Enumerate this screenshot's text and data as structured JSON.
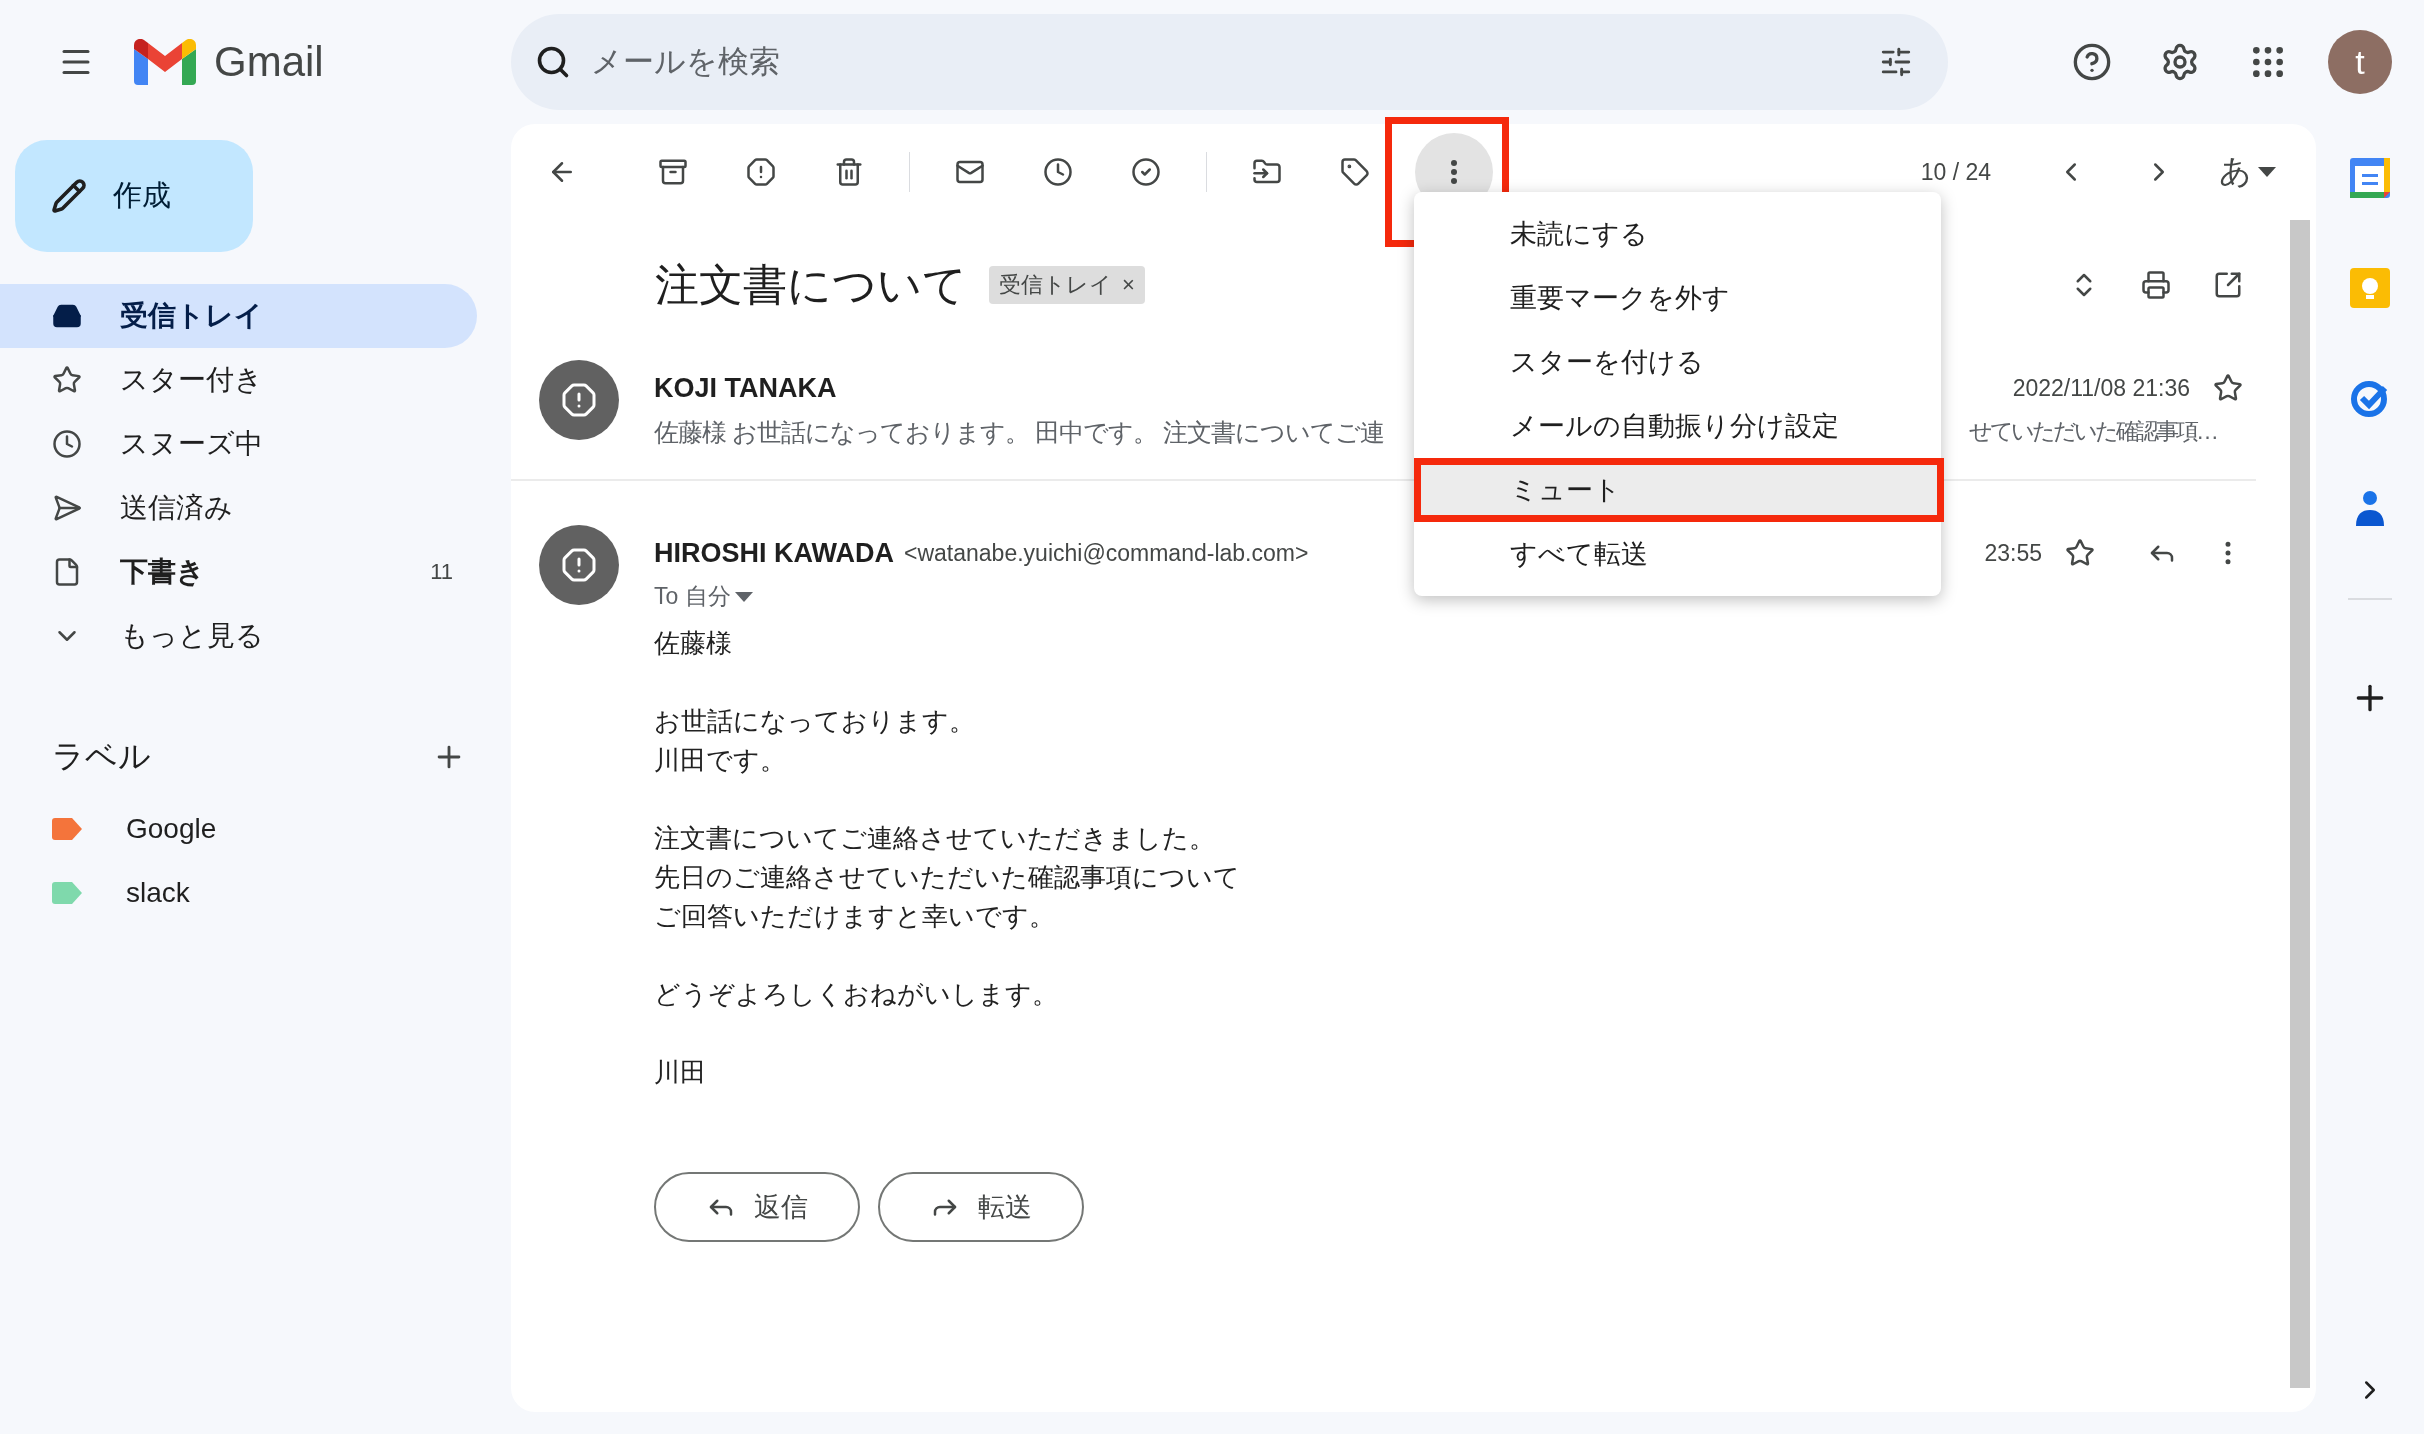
{
  "app": {
    "name": "Gmail"
  },
  "search": {
    "placeholder": "メールを検索"
  },
  "account": {
    "initial": "t"
  },
  "compose": {
    "label": "作成"
  },
  "nav": [
    {
      "label": "受信トレイ",
      "selected": true,
      "bold": true
    },
    {
      "label": "スター付き",
      "selected": false,
      "bold": false
    },
    {
      "label": "スヌーズ中",
      "selected": false,
      "bold": false
    },
    {
      "label": "送信済み",
      "selected": false,
      "bold": false
    },
    {
      "label": "下書き",
      "selected": false,
      "bold": true,
      "count": "11"
    },
    {
      "label": "もっと見る",
      "selected": false,
      "bold": false
    }
  ],
  "labels": {
    "title": "ラベル",
    "items": [
      {
        "name": "Google",
        "color": "#f4743b"
      },
      {
        "name": "slack",
        "color": "#7fd9ac"
      }
    ]
  },
  "toolbar": {
    "position": "10 / 24",
    "input_mode": "あ",
    "more_highlighted": true
  },
  "thread": {
    "subject": "注文書について",
    "tag": "受信トレイ",
    "tag_close": "×"
  },
  "messages": [
    {
      "kind": "collapsed",
      "sender": "KOJI TANAKA",
      "snippet_start": "佐藤様 お世話になっております。 田中です。 注文書についてご連",
      "snippet_end": "せていただいた確認事項…",
      "date": "2022/11/08 21:36",
      "starred": false
    },
    {
      "kind": "expanded",
      "sender": "HIROSHI KAWADA",
      "email": "<watanabe.yuichi@command-lab.com>",
      "to": "To 自分",
      "date": "23:55",
      "starred": false,
      "body": [
        [
          "佐藤様"
        ],
        [
          "お世話になっております。",
          "川田です。"
        ],
        [
          "注文書についてご連絡させていただきました。",
          "先日のご連絡させていただいた確認事項について",
          "ご回答いただけますと幸いです。"
        ],
        [
          "どうぞよろしくおねがいします。"
        ],
        [
          "川田"
        ]
      ]
    }
  ],
  "actions": [
    {
      "kind": "reply",
      "label": "返信"
    },
    {
      "kind": "forward",
      "label": "転送"
    }
  ],
  "menu": {
    "items": [
      {
        "label": "未読にする",
        "highlighted": false
      },
      {
        "label": "重要マークを外す",
        "highlighted": false
      },
      {
        "label": "スターを付ける",
        "highlighted": false
      },
      {
        "label": "メールの自動振り分け設定",
        "highlighted": false
      },
      {
        "label": "ミュート",
        "highlighted": true
      },
      {
        "label": "すべて転送",
        "highlighted": false
      }
    ]
  }
}
